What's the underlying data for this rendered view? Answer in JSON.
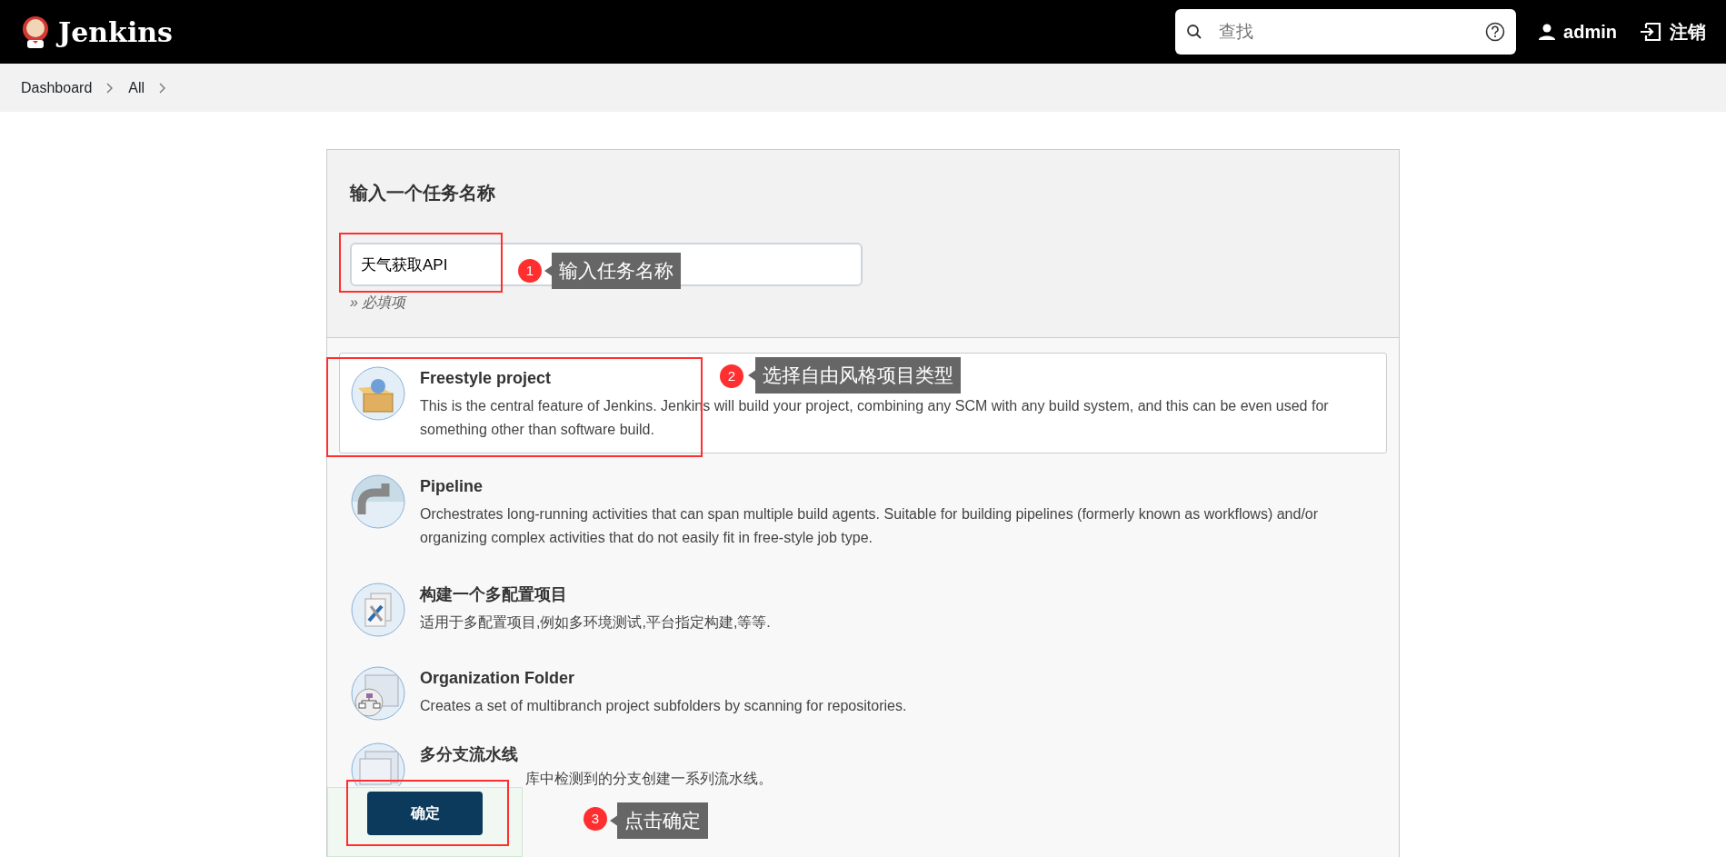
{
  "header": {
    "logo_text": "Jenkins",
    "search": {
      "placeholder": "查找"
    },
    "user": "admin",
    "logout": "注销"
  },
  "breadcrumbs": [
    "Dashboard",
    "All"
  ],
  "form": {
    "title": "输入一个任务名称",
    "name_field": {
      "value": "天气获取API"
    },
    "required_note": "» 必填项"
  },
  "items": [
    {
      "kind": "freestyle",
      "title": "Freestyle project",
      "description": "This is the central feature of Jenkins. Jenkins will build your project, combining any SCM with any build system, and this can be even used for something other than software build.",
      "selected": true
    },
    {
      "kind": "pipeline",
      "title": "Pipeline",
      "description": "Orchestrates long-running activities that can span multiple build agents. Suitable for building pipelines (formerly known as workflows) and/or organizing complex activities that do not easily fit in free-style job type.",
      "selected": false
    },
    {
      "kind": "multiconfig",
      "title": "构建一个多配置项目",
      "description": "适用于多配置项目,例如多环境测试,平台指定构建,等等.",
      "selected": false
    },
    {
      "kind": "orgfolder",
      "title": "Organization Folder",
      "description": "Creates a set of multibranch project subfolders by scanning for repositories.",
      "selected": false
    },
    {
      "kind": "multibranch",
      "title": "多分支流水线",
      "description": "库中检测到的分支创建一系列流水线。",
      "selected": false
    }
  ],
  "submit": "确定",
  "annotations": [
    {
      "number": "1",
      "text": "输入任务名称"
    },
    {
      "number": "2",
      "text": "选择自由风格项目类型"
    },
    {
      "number": "3",
      "text": "点击确定"
    }
  ]
}
